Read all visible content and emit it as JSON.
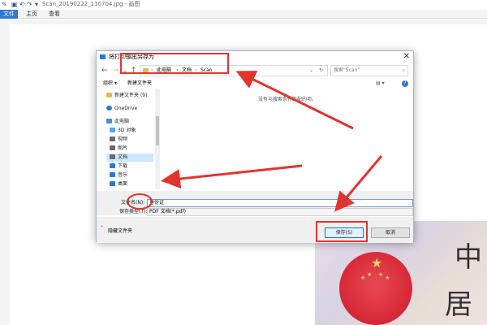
{
  "app": {
    "title": "Scan_20190222_110704.jpg - 画图",
    "ribbon_tabs": [
      "文件",
      "主页",
      "查看"
    ]
  },
  "dialog": {
    "title": "将打印输出另存为",
    "close_icon": "✕",
    "nav_icons": {
      "back": "←",
      "forward": "→",
      "dropdown": "⌄",
      "up": "↑",
      "refresh": "↻",
      "address_dropdown": "⌄"
    },
    "breadcrumb": [
      "此电脑",
      "文档",
      "Scan"
    ],
    "breadcrumb_separator": "›",
    "search_placeholder": "搜索\"Scan\"",
    "search_icon": "⌕",
    "toolbar": {
      "organize_label": "组织 ▾",
      "new_folder_label": "新建文件夹",
      "view_icon": "▤ ▾",
      "help_icon": "?"
    },
    "nav_items": [
      {
        "label": "新建文件夹 (9)",
        "icon": "folder-icon",
        "color": "#e9b949"
      },
      {
        "label": "OneDrive",
        "icon": "cloud-icon",
        "color": "#2b79d7"
      },
      {
        "label": "此电脑",
        "icon": "computer-icon",
        "color": "#3f8fd9"
      },
      {
        "label": "3D 对象",
        "icon": "cube-icon",
        "color": "#58a6e6"
      },
      {
        "label": "视频",
        "icon": "video-icon",
        "color": "#6b6b6b"
      },
      {
        "label": "图片",
        "icon": "picture-icon",
        "color": "#6b6b6b"
      },
      {
        "label": "文档",
        "icon": "document-icon",
        "color": "#6b6b6b"
      },
      {
        "label": "下载",
        "icon": "download-icon",
        "color": "#2b79d7"
      },
      {
        "label": "音乐",
        "icon": "music-icon",
        "color": "#2b79d7"
      },
      {
        "label": "桌面",
        "icon": "desktop-icon",
        "color": "#2b79d7"
      }
    ],
    "empty_message": "没有与搜索条件匹配的项。",
    "filename_label": "文件名(N):",
    "filename_value": "身份证",
    "filetype_label": "保存类型(T):",
    "filetype_value": "PDF 文档(*.pdf)",
    "hide_folders_label": "隐藏文件夹",
    "save_label": "保存(S)",
    "cancel_label": "取消"
  },
  "id_card": {
    "chars": [
      "中",
      "居"
    ]
  },
  "annotation_color": "#e2342f"
}
